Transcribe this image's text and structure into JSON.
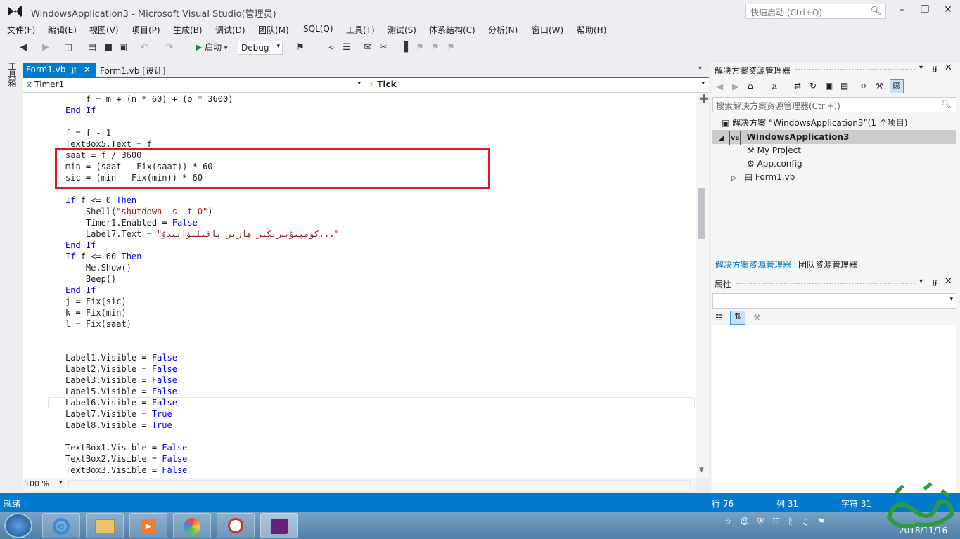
{
  "window": {
    "title": "WindowsApplication3 - Microsoft Visual Studio(管理员)",
    "quicklaunch_placeholder": "快速启动 (Ctrl+Q)"
  },
  "menu": [
    "文件(F)",
    "编辑(E)",
    "视图(V)",
    "项目(P)",
    "生成(B)",
    "调试(D)",
    "团队(M)",
    "SQL(Q)",
    "工具(T)",
    "测试(S)",
    "体系结构(C)",
    "分析(N)",
    "窗口(W)",
    "帮助(H)"
  ],
  "toolbar": {
    "start_label": "启动",
    "config_value": "Debug"
  },
  "leftstrip": {
    "toolbox_label": "工具箱"
  },
  "tabs": [
    {
      "label": "Form1.vb"
    },
    {
      "label": "Form1.vb [设计]"
    }
  ],
  "navbar": {
    "object": "Timer1",
    "method": "Tick"
  },
  "code": [
    "    f = m + (n * 60) + (o * 3600)",
    "End If",
    "",
    "f = f - 1",
    "TextBox5.Text = f",
    "saat = f / 3600",
    "min = (saat - Fix(saat)) * 60",
    "sic = (min - Fix(min)) * 60",
    "",
    "If f <= 0 Then",
    "    Shell(\"shutdown -s -t 0\")",
    "    Timer1.Enabled = False",
    "    Label7.Text = \"كومپيۇتېرىڭىز ھازىر تاقىلىۋاتىدۇ...\"",
    "End If",
    "If f <= 60 Then",
    "    Me.Show()",
    "    Beep()",
    "End If",
    "j = Fix(sic)",
    "k = Fix(min)",
    "l = Fix(saat)",
    "",
    "",
    "Label1.Visible = False",
    "Label2.Visible = False",
    "Label3.Visible = False",
    "Label5.Visible = False",
    "Label6.Visible = False",
    "Label7.Visible = True",
    "Label8.Visible = True",
    "",
    "TextBox1.Visible = False",
    "TextBox2.Visible = False",
    "TextBox3.Visible = False"
  ],
  "editor": {
    "zoom": "100 %"
  },
  "solution_explorer": {
    "title": "解决方案资源管理器",
    "search_placeholder": "搜索解决方案资源管理器(Ctrl+;)",
    "solution": "解决方案 “WindowsApplication3”(1 个项目)",
    "project": "WindowsApplication3",
    "items": [
      "My Project",
      "App.config",
      "Form1.vb"
    ],
    "bottom_tabs": [
      "解决方案资源管理器",
      "团队资源管理器"
    ]
  },
  "properties": {
    "title": "属性"
  },
  "status": {
    "ready": "就绪",
    "line": "行 76",
    "col": "列 31",
    "char": "字符 31"
  },
  "taskbar": {
    "date": "2018/11/16"
  },
  "colors": {
    "accent": "#007acc",
    "highlight_box": "#e3151e"
  }
}
